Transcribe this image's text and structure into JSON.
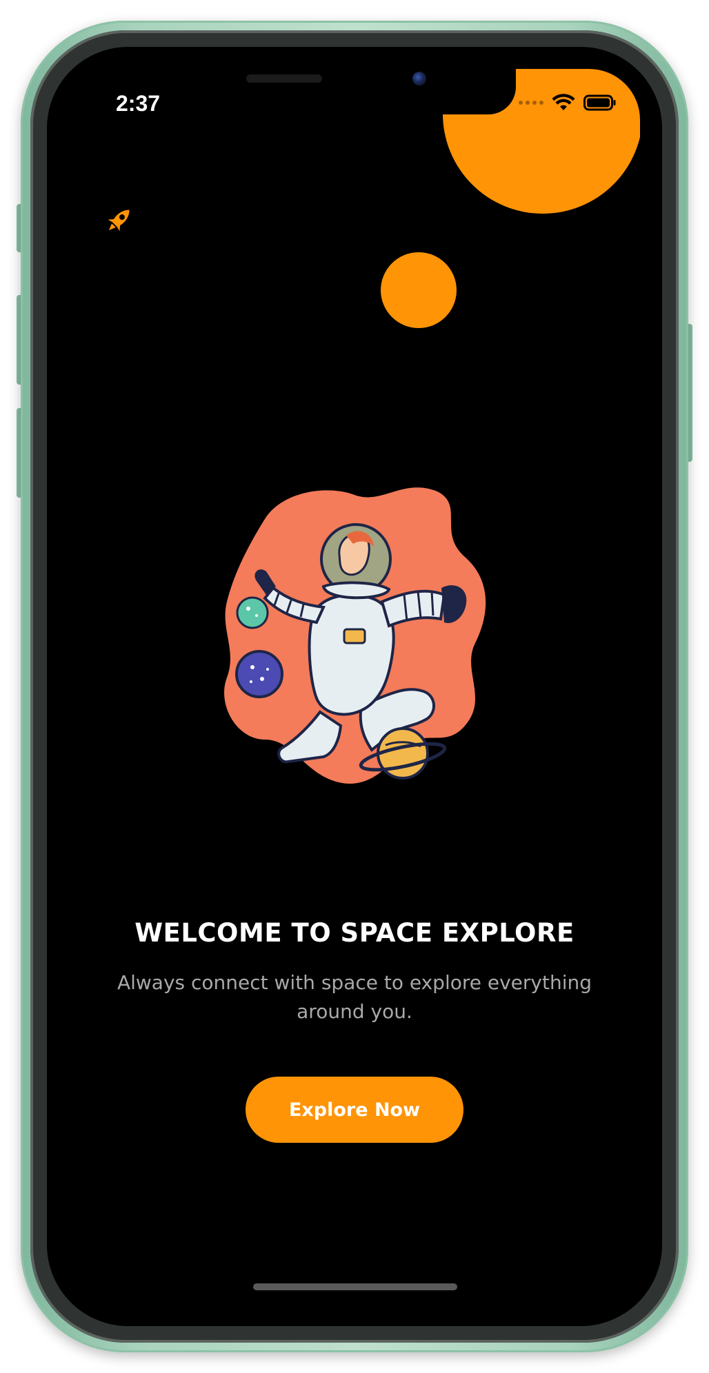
{
  "status_bar": {
    "time": "2:37"
  },
  "onboarding": {
    "title": "WELCOME TO SPACE EXPLORE",
    "subtitle": "Always connect with space to explore everything around you.",
    "cta_label": "Explore Now"
  },
  "colors": {
    "accent": "#ff9406",
    "background": "#000000",
    "subtitle_text": "#a9a9a9",
    "illustration_blob": "#f47c5a"
  },
  "icons": {
    "app_logo": "rocket-icon",
    "illustration": "astronaut-illustration"
  }
}
